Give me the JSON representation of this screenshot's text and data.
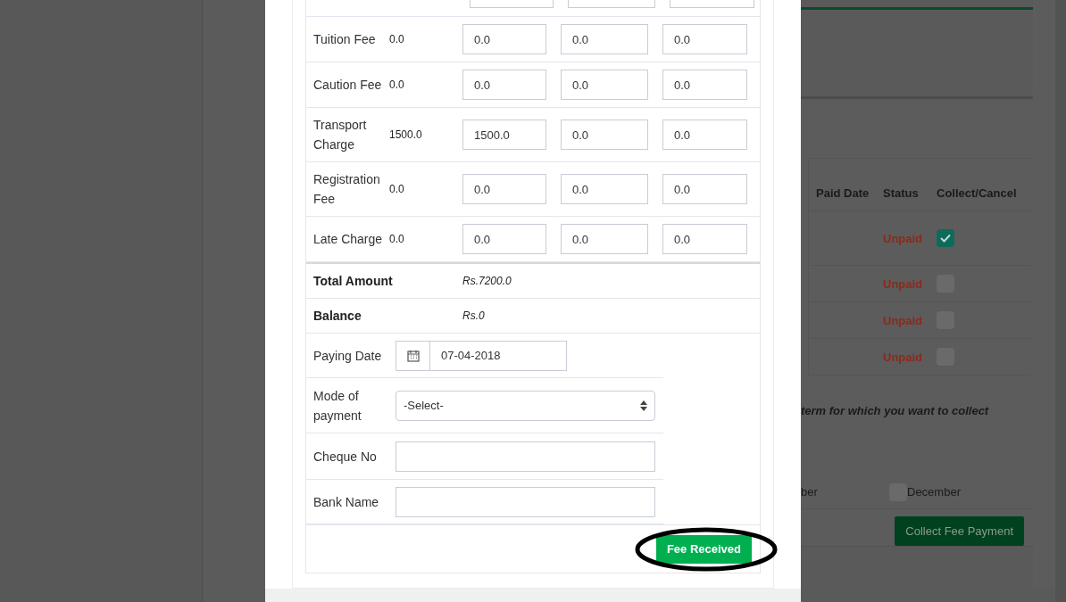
{
  "fee_rows": [
    {
      "label": "Tuition Fee",
      "amount": "0.0",
      "inputs": [
        "0.0",
        "0.0",
        "0.0"
      ]
    },
    {
      "label": "Caution Fee",
      "amount": "0.0",
      "inputs": [
        "0.0",
        "0.0",
        "0.0"
      ]
    },
    {
      "label": "Transport Charge",
      "amount": "1500.0",
      "inputs": [
        "1500.0",
        "0.0",
        "0.0"
      ]
    },
    {
      "label": "Registration Fee",
      "amount": "0.0",
      "inputs": [
        "0.0",
        "0.0",
        "0.0"
      ]
    },
    {
      "label": "Late Charge",
      "amount": "0.0",
      "inputs": [
        "0.0",
        "0.0",
        "0.0"
      ]
    }
  ],
  "totals": [
    {
      "label": "Total Amount",
      "value": "Rs.7200.0"
    },
    {
      "label": "Balance",
      "value": "Rs.0"
    }
  ],
  "payment_fields": [
    {
      "kind": "date",
      "label": "Paying Date",
      "value": "07-04-2018"
    },
    {
      "kind": "select",
      "label": "Mode of payment",
      "value": "-Select-"
    },
    {
      "kind": "text",
      "label": "Cheque No"
    },
    {
      "kind": "text",
      "label": "Bank Name"
    }
  ],
  "submit_button": "Fee Received",
  "background": {
    "columns": [
      "Paid Date",
      "Status",
      "Collect/Cancel"
    ],
    "rows": [
      {
        "status": "Unpaid",
        "checked": true
      },
      {
        "status": "Unpaid",
        "checked": false
      },
      {
        "status": "Unpaid",
        "checked": false
      },
      {
        "status": "Unpaid",
        "checked": false
      }
    ],
    "note": "term for which you want to collect",
    "months": [
      {
        "kind": "label",
        "label": "ber"
      },
      {
        "kind": "checkbox",
        "label": "December",
        "checked": false
      }
    ],
    "button": "Collect Fee Payment"
  }
}
